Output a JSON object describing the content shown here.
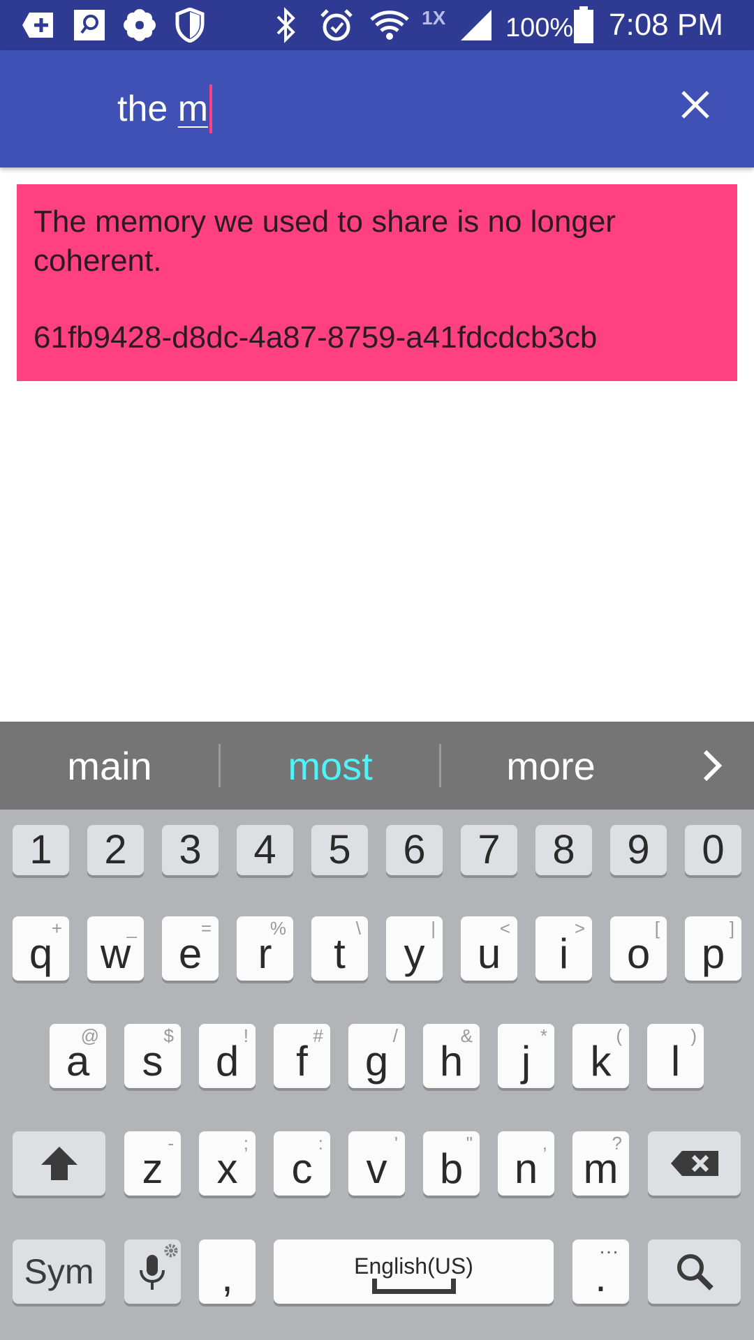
{
  "status_bar": {
    "icons": [
      "add-box-icon",
      "search-app-icon",
      "flower-icon",
      "shield-icon",
      "bluetooth-icon",
      "alarm-icon",
      "wifi-icon",
      "cell-signal-icon",
      "battery-icon"
    ],
    "network_badge": "1X",
    "battery": "100%",
    "time": "7:08 PM"
  },
  "search": {
    "query_prefix": "the ",
    "query_composing": "m",
    "clear_icon": "close-icon"
  },
  "result": {
    "text": "The memory we used to share is no longer coherent.",
    "id": "61fb9428-d8dc-4a87-8759-a41fdcdcb3cb"
  },
  "suggestions": {
    "items": [
      "main",
      "most",
      "more"
    ],
    "active_index": 1,
    "more_icon": "chevron-right-icon"
  },
  "keyboard": {
    "numbers": [
      "1",
      "2",
      "3",
      "4",
      "5",
      "6",
      "7",
      "8",
      "9",
      "0"
    ],
    "row1": [
      {
        "key": "q",
        "alt": "+"
      },
      {
        "key": "w",
        "alt": "_"
      },
      {
        "key": "e",
        "alt": "="
      },
      {
        "key": "r",
        "alt": "%"
      },
      {
        "key": "t",
        "alt": "\\"
      },
      {
        "key": "y",
        "alt": "|"
      },
      {
        "key": "u",
        "alt": "<"
      },
      {
        "key": "i",
        "alt": ">"
      },
      {
        "key": "o",
        "alt": "["
      },
      {
        "key": "p",
        "alt": "]"
      }
    ],
    "row2": [
      {
        "key": "a",
        "alt": "@"
      },
      {
        "key": "s",
        "alt": "$"
      },
      {
        "key": "d",
        "alt": "!"
      },
      {
        "key": "f",
        "alt": "#"
      },
      {
        "key": "g",
        "alt": "/"
      },
      {
        "key": "h",
        "alt": "&"
      },
      {
        "key": "j",
        "alt": "*"
      },
      {
        "key": "k",
        "alt": "("
      },
      {
        "key": "l",
        "alt": ")"
      }
    ],
    "row3": [
      {
        "key": "z",
        "alt": "-"
      },
      {
        "key": "x",
        "alt": ";"
      },
      {
        "key": "c",
        "alt": ":"
      },
      {
        "key": "v",
        "alt": "'"
      },
      {
        "key": "b",
        "alt": "\""
      },
      {
        "key": "n",
        "alt": ","
      },
      {
        "key": "m",
        "alt": "?"
      }
    ],
    "sym_label": "Sym",
    "comma": ",",
    "space_label": "English(US)",
    "period": ".",
    "period_alt": "…",
    "shift_icon": "shift-icon",
    "backspace_icon": "backspace-icon",
    "mic_icon": "microphone-icon",
    "search_icon": "search-icon"
  },
  "colors": {
    "status_bar": "#2f3a92",
    "app_bar": "#3f51b5",
    "card": "#ff4081",
    "suggestion_active": "#4ff2f7"
  }
}
